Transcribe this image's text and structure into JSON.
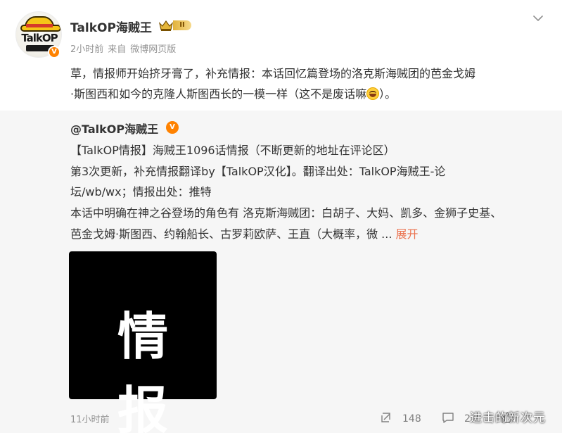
{
  "author": {
    "name": "TalkOP海贼王",
    "avatar_text": "TalkOP",
    "verified_icon": "v-verified-icon",
    "level_badge": "II",
    "crown_icon": "crown-icon"
  },
  "meta": {
    "time": "2小时前",
    "source_prefix": "来自",
    "source": "微博网页版"
  },
  "post": {
    "text_line1": "草，情报师开始挤牙膏了，补充情报：本话回忆篇登场的洛克斯海贼团的芭金戈姆",
    "text_line2a": "·斯图西和如今的克隆人斯图西长的一模一样（这不是废话嘛",
    "text_line2b": "）。",
    "emoji": "laugh-cry-emoji"
  },
  "repost": {
    "author": "@TalkOP海贼王",
    "lines": [
      "【TalkOP情报】海贼王1096话情报（不断更新的地址在评论区）",
      "第3次更新，补充情报翻译by【TalkOP汉化】。翻译出处：TalkOP海贼王-论",
      "坛/wb/wx；情报出处：推特",
      "本话中明确在神之谷登场的角色有 洛克斯海贼团：白胡子、大妈、凯多、金狮子史基、",
      "芭金戈姆·斯图西、约翰船长、古罗莉欧萨、王直（大概率，微 ... "
    ],
    "expand_label": "展开",
    "image_text": "情报"
  },
  "footer": {
    "time": "11小时前",
    "repost_count": "148",
    "comment_count": "2",
    "like_count": "",
    "watermark": "进击的新次元"
  },
  "colors": {
    "accent_orange": "#ff8200",
    "expand_link": "#eb7350",
    "repost_bg": "#f6f6f6",
    "meta_gray": "#939393"
  }
}
